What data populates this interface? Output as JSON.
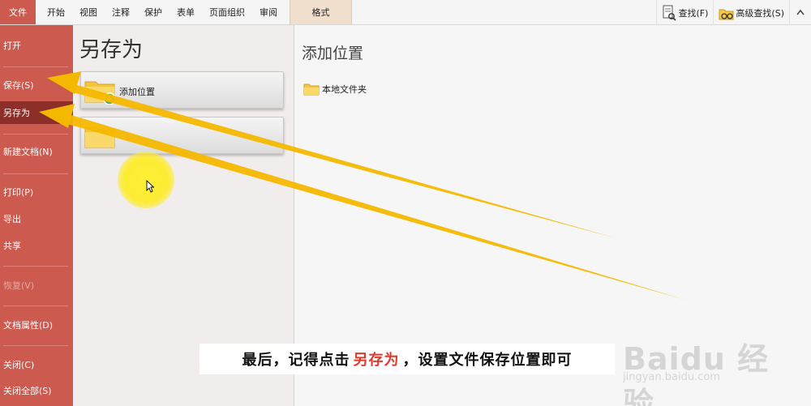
{
  "tabs": [
    "开始",
    "视图",
    "注释",
    "保护",
    "表单",
    "页面组织",
    "审阅"
  ],
  "file_tab": "文件",
  "format_tab": "格式",
  "tools": {
    "find": "查找(F)",
    "advanced_find": "高级查找(S)"
  },
  "nav": {
    "open": "打开",
    "save": "保存(S)",
    "save_as": "另存为",
    "new_doc": "新建文档(N)",
    "print": "打印(P)",
    "export": "导出",
    "share": "共享",
    "restore": "恢复(V)",
    "properties": "文档属性(D)",
    "close": "关闭(C)",
    "close_all": "关闭全部(S)"
  },
  "middle": {
    "title": "另存为",
    "add_location": "添加位置",
    "second_location": ""
  },
  "right": {
    "title": "添加位置",
    "local_folder": "本地文件夹"
  },
  "caption": {
    "before": "最后，记得点击",
    "highlight": "另存为",
    "after": "，设置文件保存位置即可"
  },
  "watermark": {
    "main": "Baidu 经验",
    "sub": "jingyan.baidu.com"
  },
  "colors": {
    "file_red": "#cc5a4e",
    "active_nav": "#8c2f28",
    "arrow": "#f5b800",
    "highlight_text": "#e03a2e"
  }
}
